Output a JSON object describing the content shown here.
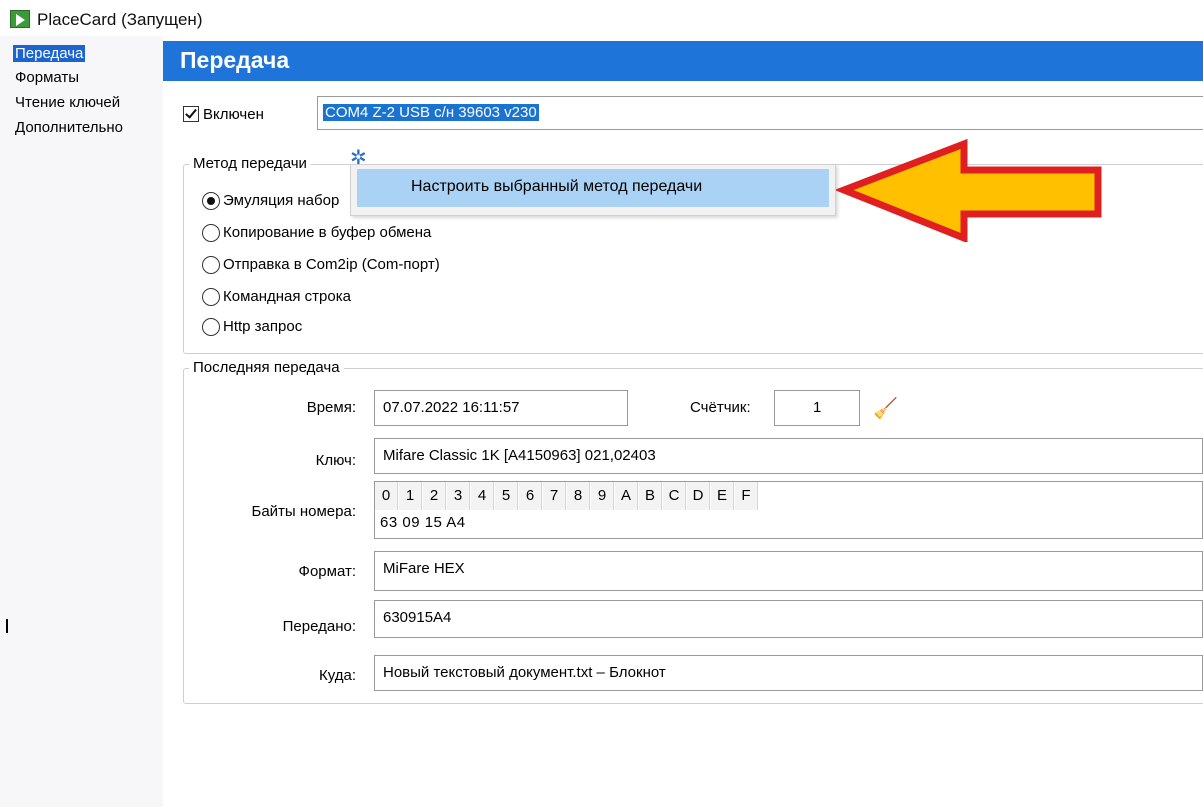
{
  "window": {
    "title": "PlaceCard (Запущен)"
  },
  "sidebar": {
    "items": [
      {
        "label": "Передача",
        "selected": true
      },
      {
        "label": "Форматы",
        "selected": false
      },
      {
        "label": "Чтение ключей",
        "selected": false
      },
      {
        "label": "Дополнительно",
        "selected": false
      }
    ]
  },
  "header": {
    "title": "Передача"
  },
  "enabled": {
    "label": "Включен",
    "checked": true
  },
  "port": {
    "value": "COM4    Z-2 USB с/н 39603 v230"
  },
  "method": {
    "group_title": "Метод передачи",
    "options": [
      {
        "label": "Эмуляция набор",
        "checked": true
      },
      {
        "label": "Копирование в буфер обмена",
        "checked": false
      },
      {
        "label": "Отправка в Com2ip (Com-порт)",
        "checked": false
      },
      {
        "label": "Командная строка",
        "checked": false
      },
      {
        "label": "Http запрос",
        "checked": false
      }
    ],
    "gear_icon": "gear-icon"
  },
  "context_menu": {
    "item": "Настроить выбранный метод передачи"
  },
  "last": {
    "group_title": "Последняя передача",
    "time_label": "Время:",
    "time_value": "07.07.2022 16:11:57",
    "counter_label": "Счётчик:",
    "counter_value": "1",
    "key_label": "Ключ:",
    "key_value": "Mifare Classic 1K [A4150963] 021,02403",
    "bytes_label": "Байты номера:",
    "hex_columns": [
      "0",
      "1",
      "2",
      "3",
      "4",
      "5",
      "6",
      "7",
      "8",
      "9",
      "A",
      "B",
      "C",
      "D",
      "E",
      "F"
    ],
    "bytes_value": "63  09  15  A4",
    "format_label": "Формат:",
    "format_value": "MiFare HEX",
    "sent_label": "Передано:",
    "sent_value": "630915A4",
    "dest_label": "Куда:",
    "dest_value": "Новый текстовый документ.txt – Блокнот"
  },
  "colors": {
    "header_bg": "#1e74d8",
    "selection": "#1c64d0",
    "menu_highlight": "#a9d2f4",
    "arrow_fill": "#ffc000",
    "arrow_stroke": "#e02020"
  }
}
